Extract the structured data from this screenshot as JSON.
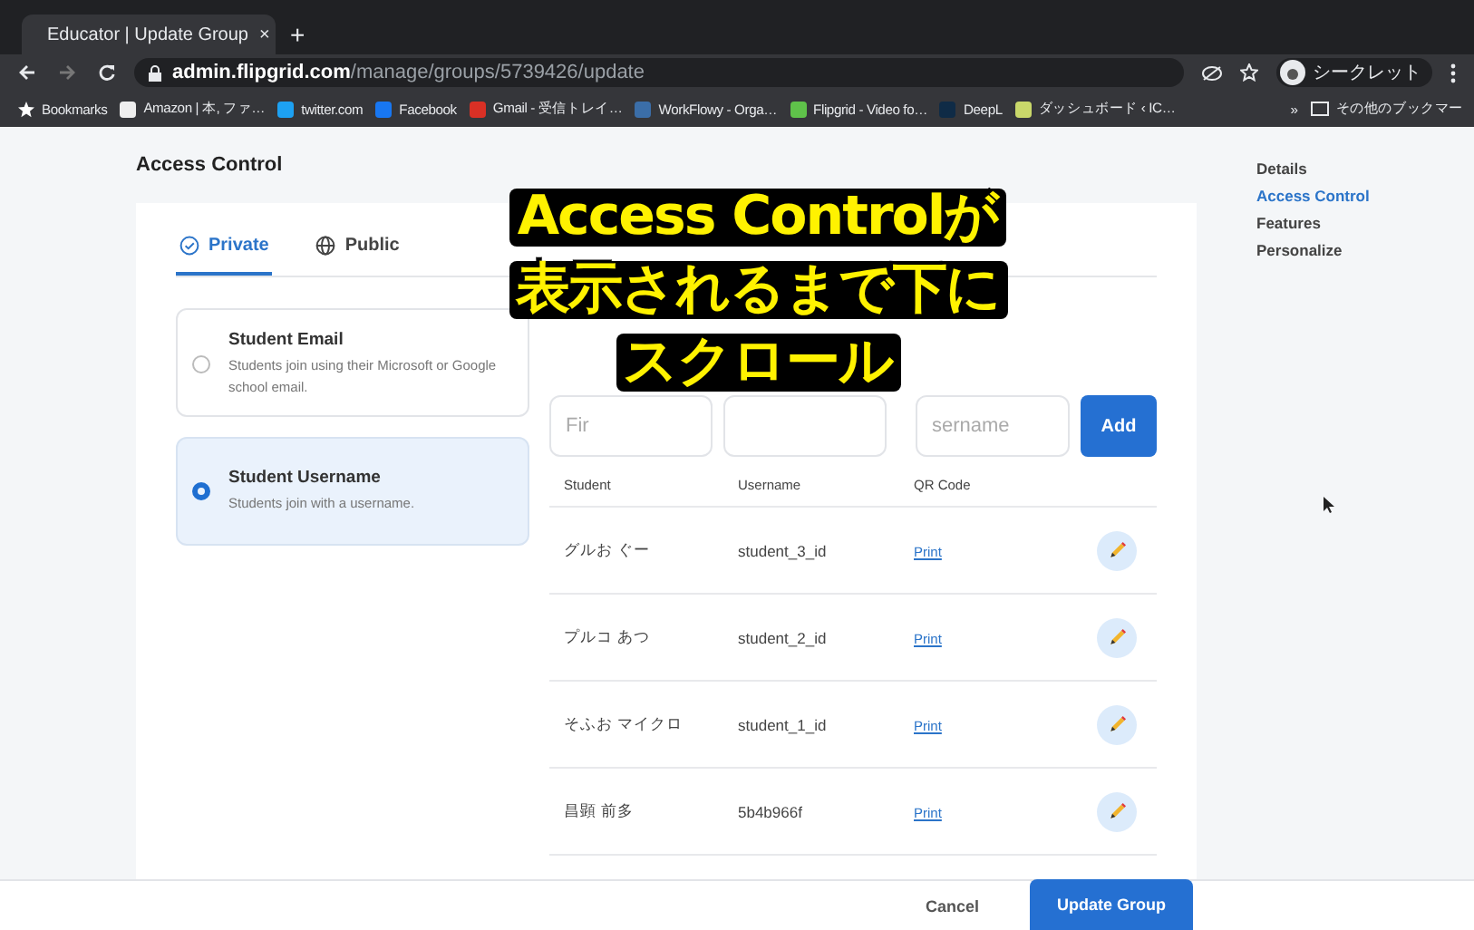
{
  "browser": {
    "tab_title": "Educator | Update Group",
    "tab_close": "×",
    "new_tab": "+",
    "url_host": "admin.flipgrid.com",
    "url_path": "/manage/groups/5739426/update",
    "profile": "シークレット",
    "bookmarks": [
      {
        "label": "Bookmarks",
        "color": "#ffffff"
      },
      {
        "label": "Amazon | 本, ファ…",
        "color": "#eeeeee"
      },
      {
        "label": "twitter.com",
        "color": "#1da1f2"
      },
      {
        "label": "Facebook",
        "color": "#1877f2"
      },
      {
        "label": "Gmail - 受信トレイ…",
        "color": "#d93025"
      },
      {
        "label": "WorkFlowy - Orga…",
        "color": "#3b6ea8"
      },
      {
        "label": "Flipgrid - Video fo…",
        "color": "#5fc24a"
      },
      {
        "label": "DeepL",
        "color": "#0f2b46"
      },
      {
        "label": "ダッシュボード ‹ IC…",
        "color": "#c9d86a"
      }
    ],
    "more": "»",
    "other_bookmarks": "その他のブックマー"
  },
  "section_title": "Access Control",
  "tabs": [
    {
      "label": "Private",
      "kind": "private",
      "selected": true
    },
    {
      "label": "Public",
      "kind": "public",
      "selected": false
    }
  ],
  "options": [
    {
      "title": "Student Email",
      "description": "Students join using their Microsoft or Google school email.",
      "selected": false
    },
    {
      "title": "Student Username",
      "description": "Students join with a username.",
      "selected": true
    }
  ],
  "add_form": {
    "fields": [
      {
        "kind": "first",
        "placeholder": "Fir"
      },
      {
        "kind": "last"
      },
      {
        "kind": "username",
        "placeholder": "sername"
      }
    ],
    "button": "Add"
  },
  "table": {
    "columns": [
      "Student",
      "Username",
      "QR Code"
    ],
    "rows": [
      {
        "student": "グルお ぐー",
        "username": "student_3_id",
        "qr": "Print"
      },
      {
        "student": "プルコ あつ",
        "username": "student_2_id",
        "qr": "Print"
      },
      {
        "student": "そふお マイクロ",
        "username": "student_1_id",
        "qr": "Print"
      },
      {
        "student": "昌顕 前多",
        "username": "5b4b966f",
        "qr": "Print"
      }
    ]
  },
  "sidebar": {
    "items": [
      {
        "label": "Details",
        "selected": false
      },
      {
        "label": "Access Control",
        "selected": true
      },
      {
        "label": "Features",
        "selected": false
      },
      {
        "label": "Personalize",
        "selected": false
      }
    ]
  },
  "footer": {
    "cancel": "Cancel",
    "submit": "Update Group"
  },
  "caption": [
    "Access Controlが",
    "表示されるまで下に",
    "スクロール"
  ]
}
